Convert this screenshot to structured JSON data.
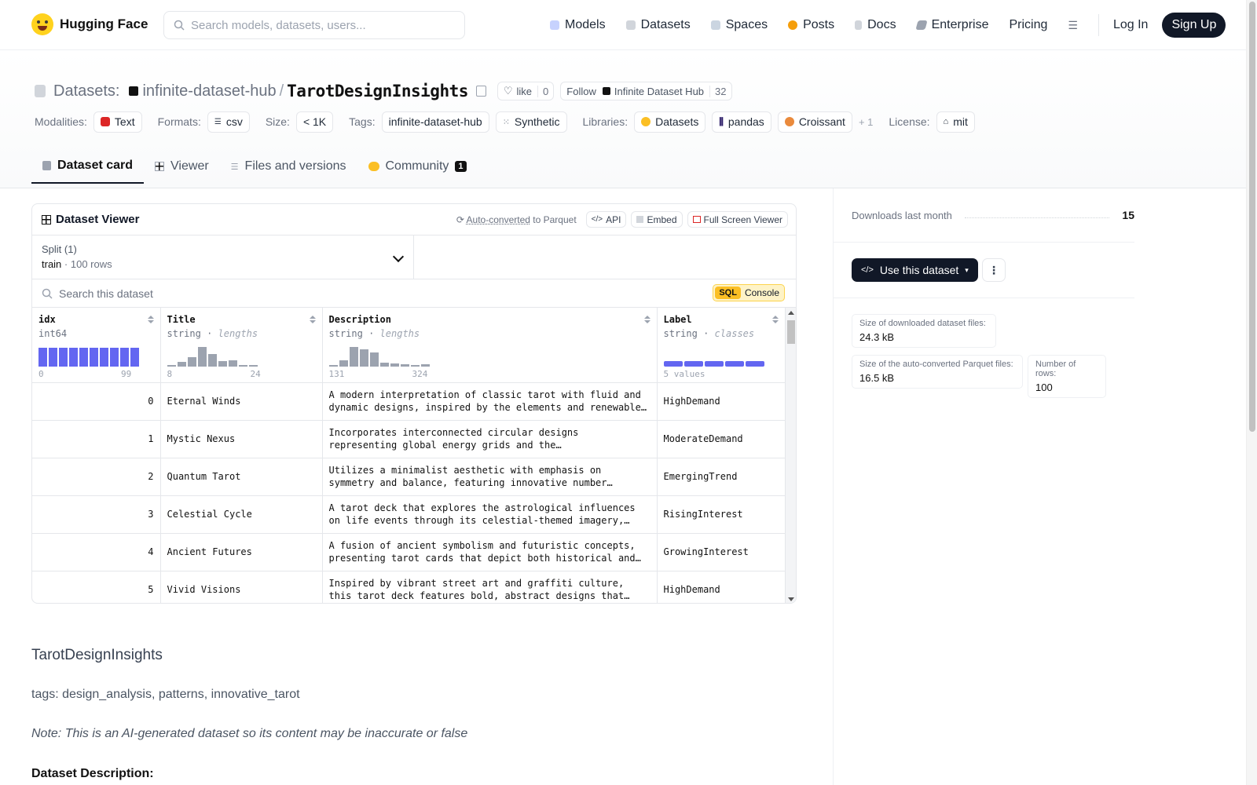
{
  "nav": {
    "brand": "Hugging Face",
    "search_placeholder": "Search models, datasets, users...",
    "links": [
      {
        "label": "Models",
        "icon": "models-icon",
        "color": "#a5b4fc"
      },
      {
        "label": "Datasets",
        "icon": "datasets-icon",
        "color": "#d1d5db"
      },
      {
        "label": "Spaces",
        "icon": "spaces-icon",
        "color": "#9ca3af"
      },
      {
        "label": "Posts",
        "icon": "posts-icon",
        "color": "#f59e0b"
      },
      {
        "label": "Docs",
        "icon": "docs-icon",
        "color": "#d1d5db"
      },
      {
        "label": "Enterprise",
        "icon": "enterprise-icon",
        "color": "#9ca3af"
      },
      {
        "label": "Pricing"
      }
    ],
    "login": "Log In",
    "signup": "Sign Up"
  },
  "header": {
    "section_label": "Datasets:",
    "owner": "infinite-dataset-hub",
    "repo": "TarotDesignInsights",
    "like_label": "like",
    "like_count": "0",
    "follow_label": "Follow",
    "follow_org": "Infinite Dataset Hub",
    "follow_count": "32",
    "meta": {
      "modalities_label": "Modalities:",
      "modality": "Text",
      "formats_label": "Formats:",
      "format": "csv",
      "size_label": "Size:",
      "size": "< 1K",
      "tags_label": "Tags:",
      "tags": [
        "infinite-dataset-hub",
        "Synthetic"
      ],
      "libraries_label": "Libraries:",
      "libraries": [
        "Datasets",
        "pandas",
        "Croissant"
      ],
      "libraries_more": "+ 1",
      "license_label": "License:",
      "license": "mit"
    }
  },
  "tabs": [
    {
      "label": "Dataset card",
      "active": true
    },
    {
      "label": "Viewer"
    },
    {
      "label": "Files and versions"
    },
    {
      "label": "Community",
      "badge": "1"
    }
  ],
  "viewer": {
    "title": "Dataset Viewer",
    "auto_converted": "Auto-converted",
    "to_parquet": "to Parquet",
    "api": "API",
    "embed": "Embed",
    "full_screen": "Full Screen Viewer",
    "split_label": "Split (1)",
    "split_value": "train",
    "split_rows": "100 rows",
    "search_placeholder": "Search this dataset",
    "sql_tag": "SQL",
    "sql_console": "Console",
    "columns": [
      {
        "name": "idx",
        "type": "int64",
        "sub": "",
        "min": "0",
        "max": "99"
      },
      {
        "name": "Title",
        "type": "string",
        "sub": "lengths",
        "min": "8",
        "max": "24"
      },
      {
        "name": "Description",
        "type": "string",
        "sub": "lengths",
        "min": "131",
        "max": "324"
      },
      {
        "name": "Label",
        "type": "string",
        "sub": "classes",
        "min": "5 values",
        "max": ""
      }
    ],
    "rows": [
      {
        "idx": "0",
        "title": "Eternal Winds",
        "desc": "A modern interpretation of classic tarot with fluid and dynamic designs, inspired by the elements and renewable…",
        "label": "HighDemand"
      },
      {
        "idx": "1",
        "title": "Mystic Nexus",
        "desc": "Incorporates interconnected circular designs representing global energy grids and the interconnectedness of all life…",
        "label": "ModerateDemand"
      },
      {
        "idx": "2",
        "title": "Quantum Tarot",
        "desc": "Utilizes a minimalist aesthetic with emphasis on symmetry and balance, featuring innovative number patterns and…",
        "label": "EmergingTrend"
      },
      {
        "idx": "3",
        "title": "Celestial Cycle",
        "desc": "A tarot deck that explores the astrological influences on life events through its celestial-themed imagery, with eac…",
        "label": "RisingInterest"
      },
      {
        "idx": "4",
        "title": "Ancient Futures",
        "desc": "A fusion of ancient symbolism and futuristic concepts, presenting tarot cards that depict both historical and…",
        "label": "GrowingInterest"
      },
      {
        "idx": "5",
        "title": "Vivid Visions",
        "desc": "Inspired by vibrant street art and graffiti culture, this tarot deck features bold, abstract designs that resonate…",
        "label": "HighDemand"
      }
    ]
  },
  "card": {
    "heading": "TarotDesignInsights",
    "tags_line": "tags: design_analysis, patterns, innovative_tarot",
    "note": "Note: This is an AI-generated dataset so its content may be inaccurate or false",
    "section": "Dataset Description:"
  },
  "sidebar": {
    "downloads_label": "Downloads last month",
    "downloads_value": "15",
    "use_dataset": "Use this dataset",
    "more": "⋮",
    "stats": [
      {
        "label": "Size of downloaded dataset files:",
        "value": "24.3 kB"
      },
      {
        "label": "Size of the auto-converted Parquet files:",
        "value": "16.5 kB"
      },
      {
        "label": "Number of rows:",
        "value": "100"
      }
    ]
  },
  "colors": {
    "accent": "#6366f1",
    "hist_gray": "#9ca3af",
    "dark": "#111827"
  }
}
